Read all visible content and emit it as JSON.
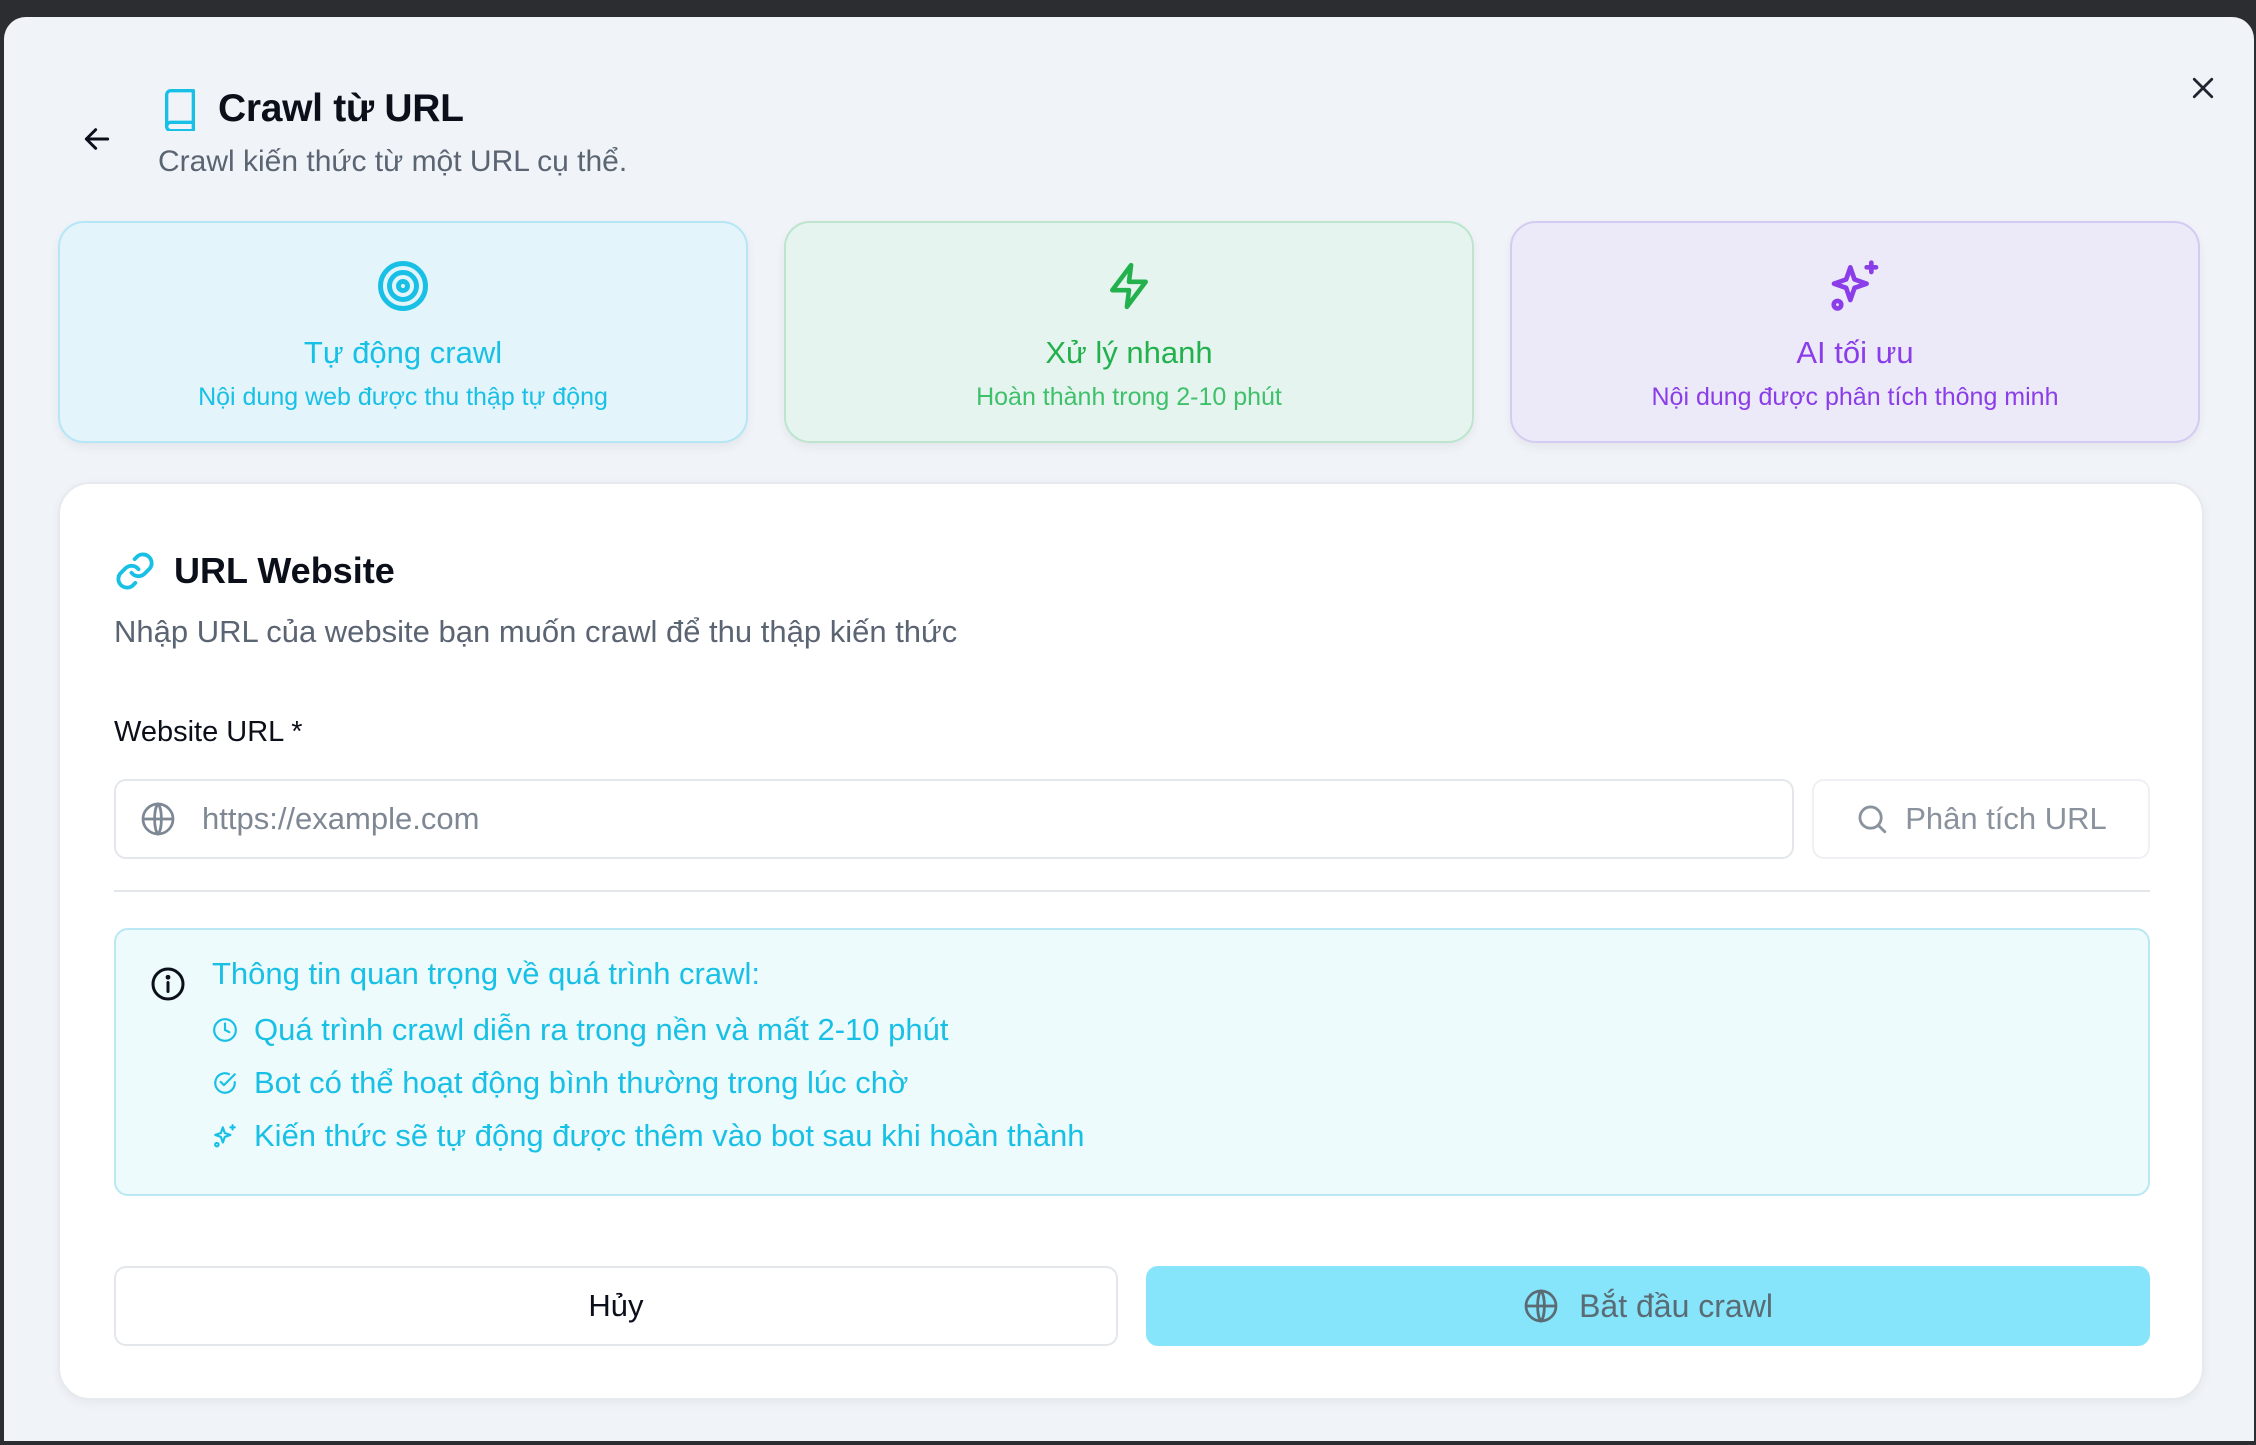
{
  "header": {
    "title": "Crawl từ URL",
    "subtitle": "Crawl kiến thức từ một URL cụ thể.",
    "icons": {
      "back": "arrow-left-icon",
      "close": "close-icon",
      "title": "book-icon"
    }
  },
  "features": [
    {
      "title": "Tự động crawl",
      "description": "Nội dung web được thu thập tự động",
      "icon": "target-icon",
      "color": "#19c0e6"
    },
    {
      "title": "Xử lý nhanh",
      "description": "Hoàn thành trong 2-10 phút",
      "icon": "zap-icon",
      "color": "#22b14c"
    },
    {
      "title": "AI tối ưu",
      "description": "Nội dung được phân tích thông minh",
      "icon": "sparkles-icon",
      "color": "#8a3de8"
    }
  ],
  "card": {
    "title": "URL Website",
    "description": "Nhập URL của website bạn muốn crawl để thu thập kiến thức",
    "field_label": "Website URL *",
    "url_value": "",
    "url_placeholder": "https://example.com",
    "analyze_label": "Phân tích URL"
  },
  "info": {
    "title": "Thông tin quan trọng về quá trình crawl:",
    "items": [
      {
        "text": "Quá trình crawl diễn ra trong nền và mất 2-10 phút",
        "icon": "clock-icon"
      },
      {
        "text": "Bot có thể hoạt động bình thường trong lúc chờ",
        "icon": "check-circle-icon"
      },
      {
        "text": "Kiến thức sẽ tự động được thêm vào bot sau khi hoàn thành",
        "icon": "sparkles-icon"
      }
    ]
  },
  "actions": {
    "cancel_label": "Hủy",
    "start_label": "Bắt đầu crawl"
  },
  "colors": {
    "accent": "#19c0e6",
    "primary_button": "#86e4fb",
    "green": "#22b14c",
    "purple": "#8a3de8"
  }
}
